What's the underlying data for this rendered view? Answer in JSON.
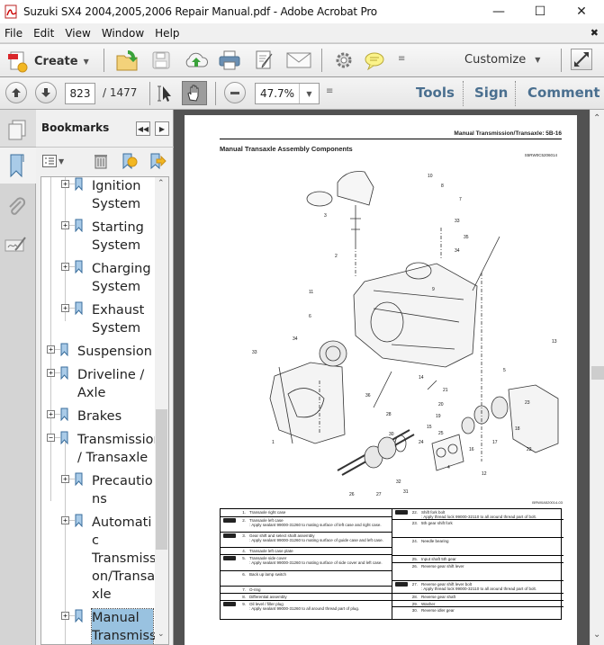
{
  "window": {
    "title": "Suzuki SX4 2004,2005,2006 Repair Manual.pdf - Adobe Acrobat Pro",
    "minimize": "—",
    "maximize": "☐",
    "close": "✕"
  },
  "menu": {
    "items": [
      "File",
      "Edit",
      "View",
      "Window",
      "Help"
    ],
    "close_doc": "✖"
  },
  "toolbar": {
    "create_label": "Create",
    "customize_label": "Customize",
    "icons": [
      "create-icon",
      "open-icon",
      "save-icon",
      "cloud-upload-icon",
      "print-icon",
      "edit-document-icon",
      "email-icon",
      "gear-icon",
      "comment-bubble-icon",
      "overflow-icon",
      "expand-icon"
    ]
  },
  "navbar": {
    "current_page": "823",
    "total_pages": "/ 1477",
    "zoom_value": "47.7%",
    "tools_label": "Tools",
    "sign_label": "Sign",
    "comment_label": "Comment"
  },
  "bookmarks": {
    "title": "Bookmarks",
    "items": [
      {
        "label": "Ignition System",
        "lines": [
          "Ignition",
          "System"
        ],
        "level": 2,
        "expander": "+"
      },
      {
        "label": "Starting System",
        "lines": [
          "Starting",
          "System"
        ],
        "level": 2,
        "expander": "+"
      },
      {
        "label": "Charging System",
        "lines": [
          "Charging",
          "System"
        ],
        "level": 2,
        "expander": "+"
      },
      {
        "label": "Exhaust System",
        "lines": [
          "Exhaust",
          "System"
        ],
        "level": 2,
        "expander": "+"
      },
      {
        "label": "Suspension",
        "lines": [
          "Suspension"
        ],
        "level": 1,
        "expander": "+"
      },
      {
        "label": "Driveline / Axle",
        "lines": [
          "Driveline /",
          "Axle"
        ],
        "level": 1,
        "expander": "+"
      },
      {
        "label": "Brakes",
        "lines": [
          "Brakes"
        ],
        "level": 1,
        "expander": "+"
      },
      {
        "label": "Transmission / Transaxle",
        "lines": [
          "Transmission",
          "/ Transaxle"
        ],
        "level": 1,
        "expander": "−"
      },
      {
        "label": "Precautions",
        "lines": [
          "Precautio",
          "ns"
        ],
        "level": 2,
        "expander": "+"
      },
      {
        "label": "Automatic Transmission/Transaxle",
        "lines": [
          "Automati",
          "c",
          "Transmissi",
          "on/Transa",
          "xle"
        ],
        "level": 2,
        "expander": "+"
      },
      {
        "label": "Manual Transmission",
        "lines": [
          "Manual",
          "Transmissi"
        ],
        "level": 2,
        "expander": "+",
        "selected": true
      }
    ]
  },
  "document": {
    "running_header": "Manual Transmission/Transaxle:   5B-16",
    "section_title": "Manual Transaxle Assembly Components",
    "section_code": "S5RW0C5206014",
    "figure_id": "I5RW0A520014-03",
    "callouts": [
      "10",
      "8",
      "7",
      "33",
      "3",
      "35",
      "34",
      "2",
      "11",
      "9",
      "6",
      "34",
      "33",
      "13",
      "14",
      "5",
      "36",
      "21",
      "20",
      "23",
      "19",
      "15",
      "25",
      "24",
      "17",
      "18",
      "16",
      "22",
      "12",
      "28",
      "30",
      "4",
      "32",
      "31",
      "29",
      "26",
      "27",
      "1"
    ],
    "parts_left": [
      {
        "num": "1.",
        "text": "Transaxle right case",
        "badge": false
      },
      {
        "num": "2.",
        "text": "Transaxle left case",
        "note": ": Apply sealant 99000-31260 to mating surface of left case and right case.",
        "badge": true
      },
      {
        "num": "3.",
        "text": "Gear shift and select shaft assembly",
        "note": ": Apply sealant 99000-31260 to mating surface of guide case and left case.",
        "badge": true
      },
      {
        "num": "4.",
        "text": "Transaxle left case plate",
        "badge": false
      },
      {
        "num": "5.",
        "text": "Transaxle side cover",
        "note": ": Apply sealant 99000-31260 to mating surface of side cover and left case.",
        "badge": true
      },
      {
        "num": "6.",
        "text": "Back up lamp switch",
        "badge": false
      },
      {
        "num": "7.",
        "text": "O-ring",
        "badge": false
      },
      {
        "num": "8.",
        "text": "Differential assembly",
        "badge": false
      },
      {
        "num": "9.",
        "text": "Oil level / filler plug",
        "note": ": Apply sealant 99000-31260 to all around thread part of plug.",
        "badge": true
      }
    ],
    "parts_right": [
      {
        "num": "22.",
        "text": "Shift fork bolt",
        "note": ": Apply thread lock 99000-32110 to all around thread part of bolt.",
        "badge": true
      },
      {
        "num": "23.",
        "text": "5th gear shift fork",
        "badge": false
      },
      {
        "num": "24.",
        "text": "Needle bearing",
        "badge": false
      },
      {
        "num": "25.",
        "text": "Input shaft 5th gear",
        "badge": false
      },
      {
        "num": "26.",
        "text": "Reverse gear shift lever",
        "badge": false
      },
      {
        "num": "27.",
        "text": "Reverse gear shift lever bolt",
        "note": ": Apply thread lock 99000-32110 to all around thread part of bolt.",
        "badge": true
      },
      {
        "num": "28.",
        "text": "Reverse gear shaft",
        "badge": false
      },
      {
        "num": "29.",
        "text": "Washer",
        "badge": false
      },
      {
        "num": "30.",
        "text": "Reverse idler gear",
        "badge": false
      }
    ]
  },
  "colors": {
    "accent": "#4a6f8f",
    "selection": "#99c2e0",
    "doc_bg": "#525252"
  }
}
